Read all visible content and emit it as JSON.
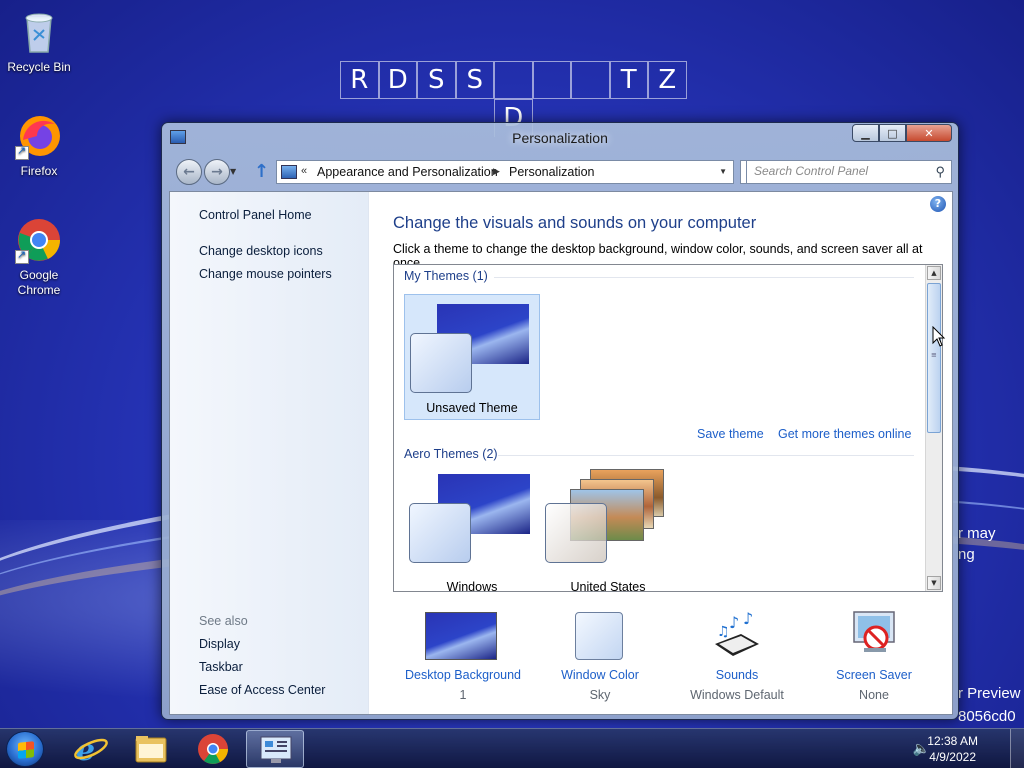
{
  "desktop": {
    "icons": [
      {
        "label": "Recycle Bin"
      },
      {
        "label": "Firefox"
      },
      {
        "label": "Google Chrome"
      }
    ],
    "wall_letters": [
      "R",
      "D",
      "S",
      "S",
      "",
      "",
      "",
      "T",
      "Z"
    ],
    "wall_letter_row2": "D",
    "wall_text_right_1": "r may",
    "wall_text_right_2": "ng",
    "wall_text_right_3": "r Preview",
    "wall_text_right_4": "8056cd0"
  },
  "window": {
    "title": "Personalization",
    "breadcrumb": {
      "overflow": "«",
      "items": [
        "Appearance and Personalization",
        "Personalization"
      ]
    },
    "search_placeholder": "Search Control Panel",
    "left_pane": {
      "links": [
        "Control Panel Home",
        "Change desktop icons",
        "Change mouse pointers"
      ],
      "see_also_label": "See also",
      "see_also_links": [
        "Display",
        "Taskbar",
        "Ease of Access Center"
      ]
    },
    "main": {
      "title": "Change the visuals and sounds on your computer",
      "description": "Click a theme to change the desktop background, window color, sounds, and screen saver all at once.",
      "groups": [
        {
          "header": "My Themes (1)",
          "themes": [
            {
              "name": "Unsaved Theme",
              "selected": true
            }
          ]
        },
        {
          "header": "Aero Themes (2)",
          "themes": [
            {
              "name": "Windows"
            },
            {
              "name": "United States"
            }
          ]
        }
      ],
      "save_theme": "Save theme",
      "get_more": "Get more themes online"
    },
    "bottom_items": [
      {
        "label": "Desktop Background",
        "sub": "1",
        "icon": "desktop-background-icon"
      },
      {
        "label": "Window Color",
        "sub": "Sky",
        "icon": "window-color-icon"
      },
      {
        "label": "Sounds",
        "sub": "Windows Default",
        "icon": "sounds-icon"
      },
      {
        "label": "Screen Saver",
        "sub": "None",
        "icon": "screen-saver-icon"
      }
    ]
  },
  "taskbar": {
    "time": "12:38 AM",
    "date": "4/9/2022",
    "pinned": [
      "internet-explorer-icon",
      "file-explorer-icon",
      "chrome-icon",
      "control-panel-icon"
    ]
  },
  "colors": {
    "link": "#1d5fc9",
    "heading": "#1e3f8a",
    "desktop": "#2634b8"
  }
}
